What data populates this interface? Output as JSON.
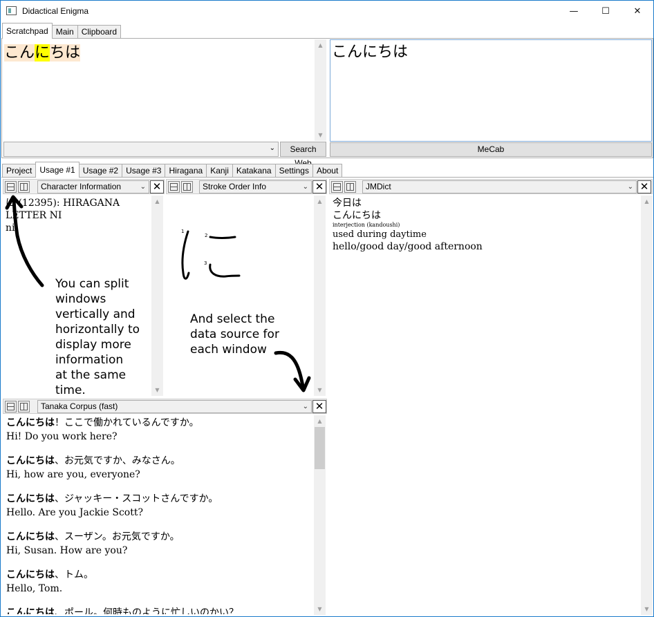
{
  "window": {
    "title": "Didactical Enigma",
    "minimize": "—",
    "maximize": "☐",
    "close": "✕"
  },
  "top_tabs": [
    "Scratchpad",
    "Main",
    "Clipboard"
  ],
  "scratchpad": {
    "text_before": "こん",
    "text_highlight": "に",
    "text_after": "ちは",
    "search_combo_value": "",
    "search_web_label": "Search Web"
  },
  "mecab": {
    "text": "こんにちは",
    "button_label": "MeCab"
  },
  "bottom_tabs": [
    "Project",
    "Usage #1",
    "Usage #2",
    "Usage #3",
    "Hiragana",
    "Kanji",
    "Katakana",
    "Settings",
    "About"
  ],
  "panes": {
    "char_info": {
      "source": "Character Information",
      "lines": [
        "に (12395): HIRAGANA",
        "LETTER NI",
        "ni"
      ]
    },
    "stroke_order": {
      "source": "Stroke Order Info",
      "char": "に",
      "stroke_numbers": [
        "1",
        "2",
        "3"
      ]
    },
    "jmdict": {
      "source": "JMDict",
      "word": "今日は",
      "reading": "こんにちは",
      "pos": "interjection (kandoushi)",
      "note": "used during daytime",
      "gloss": "hello/good day/good afternoon"
    },
    "tanaka": {
      "source": "Tanaka Corpus (fast)",
      "sentences": [
        {
          "bold": "こんにちは",
          "rest": "！ここで働かれているんですか。",
          "en": "Hi! Do you work here?"
        },
        {
          "bold": "こんにちは",
          "rest": "、お元気ですか、みなさん。",
          "en": "Hi, how are you, everyone?"
        },
        {
          "bold": "こんにちは",
          "rest": "、ジャッキー・スコットさんですか。",
          "en": "Hello. Are you Jackie Scott?"
        },
        {
          "bold": "こんにちは",
          "rest": "、スーザン。お元気ですか。",
          "en": "Hi, Susan. How are you?"
        },
        {
          "bold": "こんにちは",
          "rest": "、トム。",
          "en": "Hello, Tom."
        },
        {
          "bold": "こんにちは",
          "rest": "、ポール。何時ものように忙しいのかい？",
          "en": ""
        }
      ]
    }
  },
  "annotations": {
    "split_note": [
      "You can split",
      "windows",
      "vertically and",
      "horizontally to",
      "display more",
      "information",
      "at the same",
      "time."
    ],
    "select_note": [
      "And select the",
      "data source for",
      "each window"
    ]
  },
  "colors": {
    "highlight": "#ffff00",
    "selected_bg": "#fde8d0",
    "accent_border": "#1979ca"
  }
}
